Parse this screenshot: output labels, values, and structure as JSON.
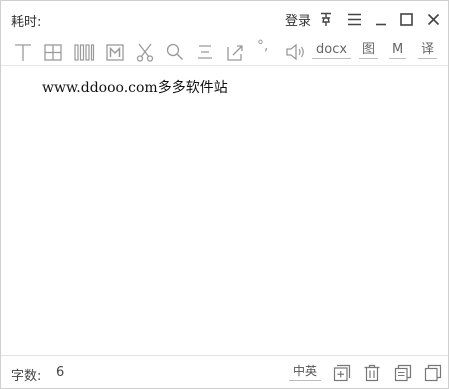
{
  "title": "耗时:",
  "header": {
    "login_label": "登录",
    "icons": [
      "pin-icon",
      "menu-icon",
      "minimize-icon",
      "maximize-icon",
      "close-icon"
    ]
  },
  "toolbar": {
    "icons": [
      "text-cursor-icon",
      "grid-icon",
      "columns-icon",
      "merge-icon",
      "scissors-icon",
      "search-icon",
      "align-icon",
      "resize-icon",
      "punctuation-icon",
      "speaker-icon"
    ],
    "punct_glyph": "°,",
    "docx_label": "docx",
    "image_label": "图",
    "m_label": "M",
    "translate_label": "译"
  },
  "editor": {
    "content": "www.ddooo.com多多软件站"
  },
  "status": {
    "count_label": "字数:",
    "count_value": "6",
    "lang_toggle": "中英",
    "icons": [
      "add-page-icon",
      "trash-icon",
      "copy-icon",
      "duplicate-icon"
    ]
  },
  "colors": {
    "icon": "#9a9a9a",
    "text": "#333333",
    "border": "#cfcfcf"
  }
}
